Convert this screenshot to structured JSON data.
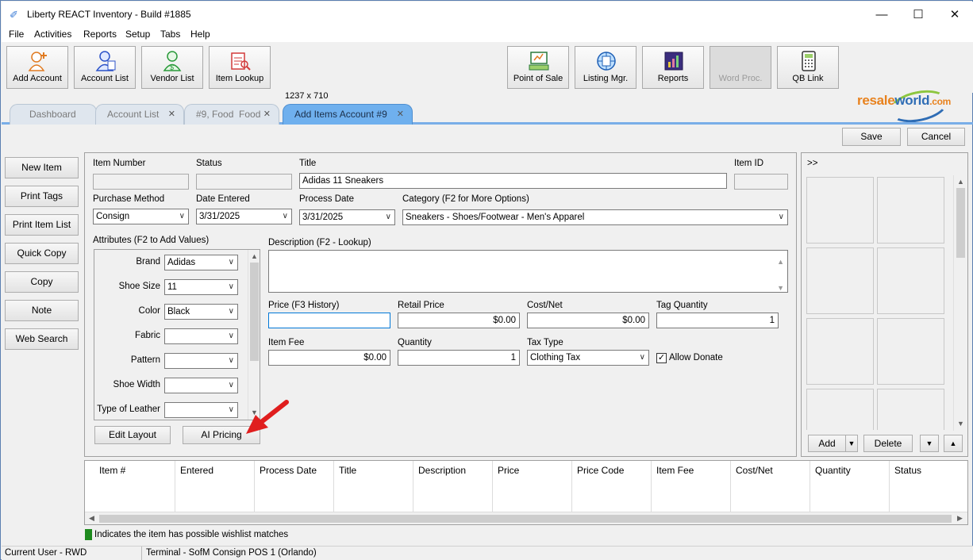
{
  "window": {
    "title": "Liberty REACT Inventory - Build #1885"
  },
  "menu": [
    "File",
    "Activities",
    "Reports",
    "Setup",
    "Tabs",
    "Help"
  ],
  "toolbar": {
    "left": [
      {
        "label": "Add Account",
        "icon": "add-account-icon"
      },
      {
        "label": "Account List",
        "icon": "account-list-icon"
      },
      {
        "label": "Vendor List",
        "icon": "vendor-list-icon"
      },
      {
        "label": "Item Lookup",
        "icon": "item-lookup-icon"
      }
    ],
    "dims": "1237 x 710",
    "right": [
      {
        "label": "Point of Sale",
        "icon": "point-of-sale-icon"
      },
      {
        "label": "Listing Mgr.",
        "icon": "listing-manager-icon"
      },
      {
        "label": "Reports",
        "icon": "reports-icon"
      },
      {
        "label": "Word Proc.",
        "icon": "word-processor-icon",
        "disabled": true
      },
      {
        "label": "QB Link",
        "icon": "qb-link-icon"
      }
    ],
    "logo": {
      "part1": "resale",
      "part2": "world",
      "part3": ".com"
    }
  },
  "tabs": [
    {
      "label": "Dashboard",
      "closable": false
    },
    {
      "label": "Account List",
      "closable": true
    },
    {
      "label": "#9, Food  Food",
      "closable": true
    },
    {
      "label": "Add Items Account #9",
      "closable": true,
      "active": true
    }
  ],
  "actions": {
    "save": "Save",
    "cancel": "Cancel"
  },
  "sidebar": [
    "New Item",
    "Print Tags",
    "Print Item List",
    "Quick Copy",
    "Copy",
    "Note",
    "Web Search"
  ],
  "form": {
    "item_number": {
      "label": "Item Number",
      "value": ""
    },
    "status": {
      "label": "Status",
      "value": ""
    },
    "title": {
      "label": "Title",
      "value": "Adidas 11 Sneakers"
    },
    "item_id": {
      "label": "Item ID",
      "value": ""
    },
    "purchase_method": {
      "label": "Purchase Method",
      "value": "Consign"
    },
    "date_entered": {
      "label": "Date Entered",
      "value": "3/31/2025"
    },
    "process_date": {
      "label": "Process Date",
      "value": "3/31/2025"
    },
    "category": {
      "label": "Category (F2 for More Options)",
      "value": "Sneakers - Shoes/Footwear - Men's Apparel"
    },
    "attributes_label": "Attributes (F2 to Add Values)",
    "attributes": [
      {
        "label": "Brand",
        "value": "Adidas"
      },
      {
        "label": "Shoe Size",
        "value": "11"
      },
      {
        "label": "Color",
        "value": "Black"
      },
      {
        "label": "Fabric",
        "value": ""
      },
      {
        "label": "Pattern",
        "value": ""
      },
      {
        "label": "Shoe Width",
        "value": ""
      },
      {
        "label": "Type of Leather",
        "value": ""
      }
    ],
    "description": {
      "label": "Description (F2 - Lookup)",
      "value": ""
    },
    "price": {
      "label": "Price (F3 History)",
      "value": ""
    },
    "retail_price": {
      "label": "Retail Price",
      "value": "$0.00"
    },
    "cost_net": {
      "label": "Cost/Net",
      "value": "$0.00"
    },
    "tag_quantity": {
      "label": "Tag Quantity",
      "value": "1"
    },
    "item_fee": {
      "label": "Item Fee",
      "value": "$0.00"
    },
    "quantity": {
      "label": "Quantity",
      "value": "1"
    },
    "tax_type": {
      "label": "Tax Type",
      "value": "Clothing Tax"
    },
    "allow_donate": {
      "label": "Allow Donate",
      "checked": true
    },
    "edit_layout": "Edit Layout",
    "ai_pricing": "AI Pricing"
  },
  "images": {
    "toggle": ">>",
    "add": "Add",
    "delete": "Delete"
  },
  "table": {
    "columns": [
      "Item #",
      "Entered",
      "Process Date",
      "Title",
      "Description",
      "Price",
      "Price Code",
      "Item Fee",
      "Cost/Net",
      "Quantity",
      "Status"
    ]
  },
  "legend": {
    "text": "Indicates the item has possible wishlist matches",
    "color": "#1e8a1e"
  },
  "status": {
    "user": "Current User - RWD",
    "terminal": "Terminal - SofM Consign POS 1 (Orlando)"
  }
}
